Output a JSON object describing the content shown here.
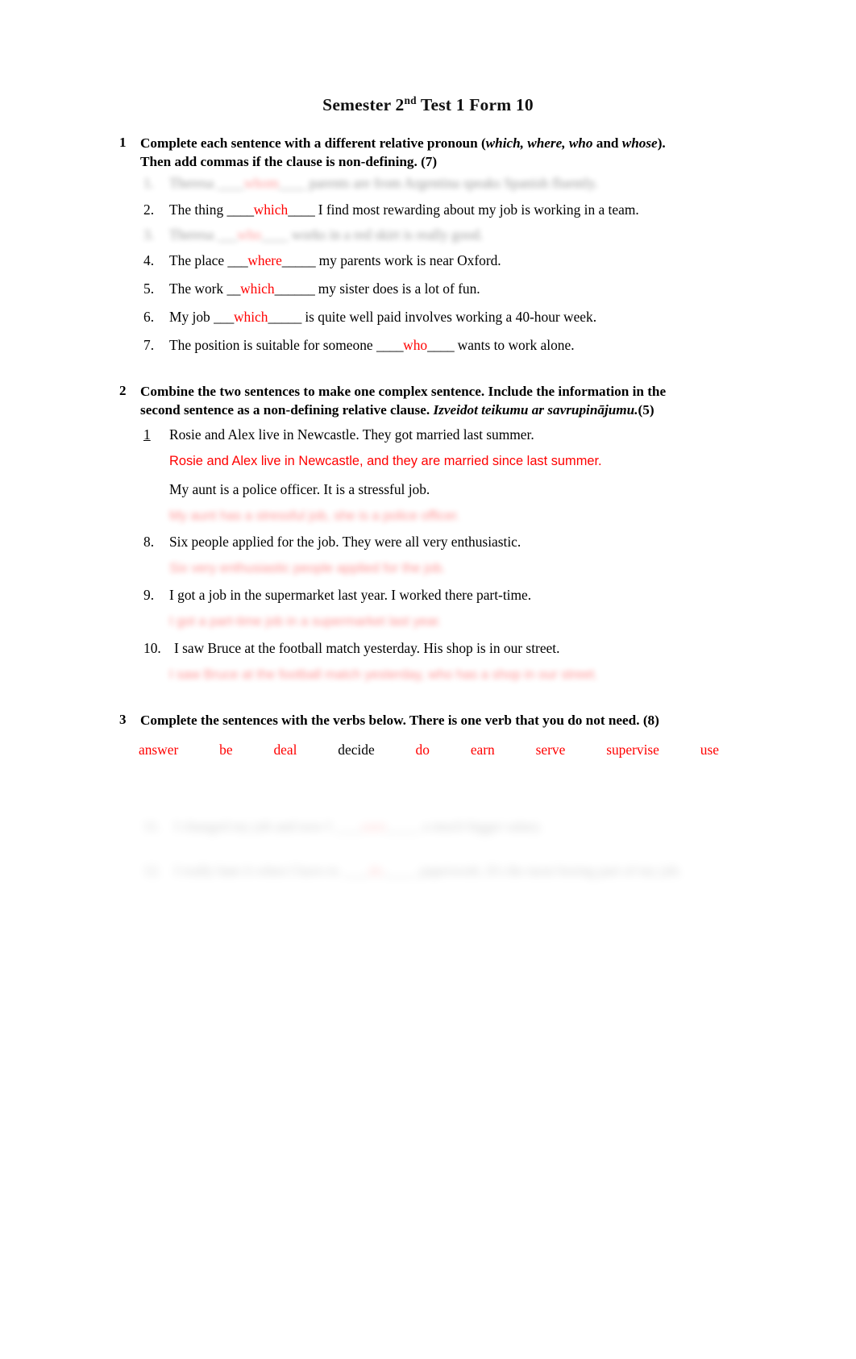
{
  "document": {
    "title_prefix": "Semester 2",
    "title_sup": "nd",
    "title_suffix": " Test 1  Form 10"
  },
  "exercise1": {
    "number": "1",
    "instruction_part1": "Complete each sentence with a different relative pronoun (",
    "instruction_italic1": "which, where, who",
    "instruction_part2": " and ",
    "instruction_italic2": "whose",
    "instruction_part3": "). Then add commas if the clause is non-defining. (7)",
    "items": [
      {
        "index": "1.",
        "before": "Theresa ",
        "blank_before": "____",
        "answer": "whom",
        "blank_after": "____",
        "after": " parents are from Argentina speaks Spanish fluently.",
        "redacted": true
      },
      {
        "index": "2.",
        "before": "The thing ",
        "blank_before": "____",
        "answer": "which",
        "blank_after": "____",
        "after": " I find most rewarding about my job is working in a team.",
        "redacted": false
      },
      {
        "index": "3.",
        "before": "Theresa ",
        "blank_before": "___",
        "answer": "who",
        "blank_after": "____",
        "after": " works in a red skirt is really good.",
        "redacted": true
      },
      {
        "index": "4.",
        "before": "The place ",
        "blank_before": "___",
        "answer": "where",
        "blank_after": "_____",
        "after": " my parents work is near Oxford.",
        "redacted": false
      },
      {
        "index": "5.",
        "before": "The work ",
        "blank_before": "__",
        "answer": "which",
        "blank_after": "______",
        "after": " my sister does is a lot of fun.",
        "redacted": false
      },
      {
        "index": "6.",
        "before": "My job ",
        "blank_before": "___",
        "answer": "which",
        "blank_after": "_____",
        "after": " is quite well paid involves working a 40-hour week.",
        "redacted": false
      },
      {
        "index": "7.",
        "before": "The position is suitable for someone ",
        "blank_before": "____",
        "answer": "who",
        "blank_after": "____",
        "after": " wants to work alone.",
        "redacted": false
      }
    ]
  },
  "exercise2": {
    "number": "2",
    "instruction_bold": "Combine the two sentences to make one complex sentence. Include the information in the second sentence as a non-defining relative clause. ",
    "instruction_italic": "Izveidot teikumu ar savrupinājumu.",
    "instruction_tail": "(5)",
    "items": [
      {
        "index": "1",
        "index_underline": true,
        "prompt": "Rosie and Alex live in Newcastle. They got married last summer.",
        "answer": "Rosie and Alex live in Newcastle, and they are married since last summer.",
        "answer_redacted": false
      },
      {
        "index": "",
        "index_underline": false,
        "prompt": "My aunt is a police officer. It is a stressful job.",
        "answer": "My aunt has a stressful job, she is a police officer.",
        "answer_redacted": true
      },
      {
        "index": "8.",
        "index_underline": false,
        "prompt": "Six people applied for the job. They were all very enthusiastic.",
        "answer": "Six very enthusiastic people applied for the job.",
        "answer_redacted": true
      },
      {
        "index": "9.",
        "index_underline": false,
        "prompt": "I got a job in the supermarket last year. I worked there part-time.",
        "answer": "I got a part-time job in a supermarket last year.",
        "answer_redacted": true
      },
      {
        "index": "10.",
        "index_underline": false,
        "prompt": "I saw Bruce at the football match yesterday. His shop is in our street.",
        "answer": "I saw Bruce at the football match yesterday, who has a shop in our street.",
        "answer_redacted": true
      }
    ]
  },
  "exercise3": {
    "number": "3",
    "instruction": "Complete the sentences with the verbs below. There is one verb that you do not need.  (8)",
    "word_bank": [
      {
        "word": "answer",
        "color": "#FF0000"
      },
      {
        "word": "be",
        "color": "#FF0000"
      },
      {
        "word": "deal",
        "color": "#FF0000"
      },
      {
        "word": "decide",
        "color": "#000000"
      },
      {
        "word": "do",
        "color": "#FF0000"
      },
      {
        "word": "earn",
        "color": "#FF0000"
      },
      {
        "word": "serve",
        "color": "#FF0000"
      },
      {
        "word": "supervise",
        "color": "#FF0000"
      },
      {
        "word": "use",
        "color": "#FF0000"
      }
    ],
    "items": [
      {
        "index": "11.",
        "before": "I changed my job and now I ",
        "blank_before": "____",
        "answer": "earn",
        "blank_after": "_____",
        "after": " a much bigger salary.",
        "redacted": true
      },
      {
        "index": "12.",
        "before": "I really hate it when I have to ",
        "blank_before": "____",
        "answer": "do",
        "blank_after": "_____",
        "after": " paperwork. It's the most boring part of my job.",
        "redacted": true
      }
    ]
  },
  "colors": {
    "answer_red": "#FF0000",
    "text_black": "#000000",
    "page_background": "#FFFFFF"
  }
}
